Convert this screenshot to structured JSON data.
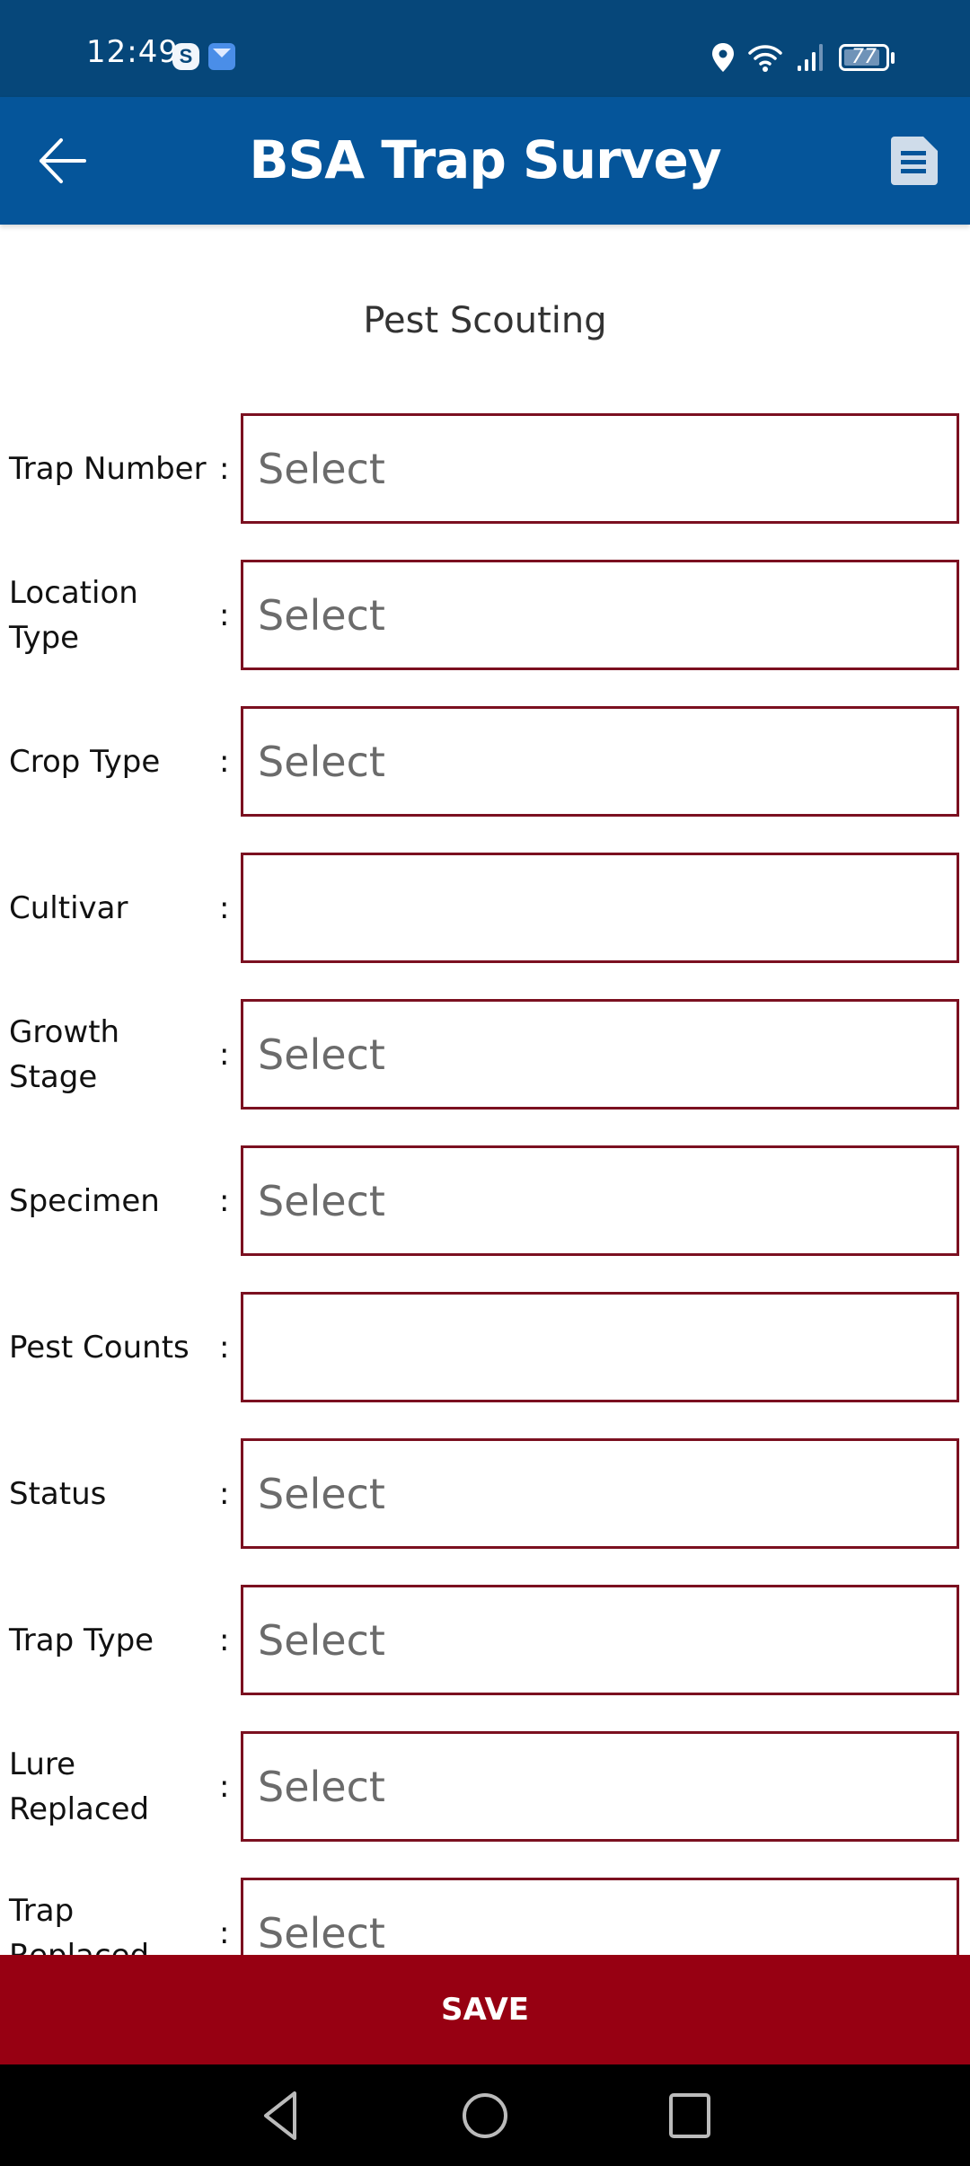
{
  "status_bar": {
    "time": "12:49",
    "notification_icons": [
      "skype-icon",
      "mail-icon"
    ],
    "system_icons": [
      "location-icon",
      "wifi-icon",
      "signal-icon",
      "battery-icon"
    ],
    "battery_level": "77",
    "skype_glyph": "S"
  },
  "app_bar": {
    "title": "BSA Trap Survey",
    "back_icon": "arrow-left-icon",
    "action_icon": "document-icon"
  },
  "section_title": "Pest Scouting",
  "form": {
    "fields": [
      {
        "label": "Trap Number",
        "value": "Select",
        "type": "select"
      },
      {
        "label": "Location Type",
        "value": "Select",
        "type": "select"
      },
      {
        "label": "Crop Type",
        "value": "Select",
        "type": "select"
      },
      {
        "label": "Cultivar",
        "value": "",
        "type": "text"
      },
      {
        "label": "Growth Stage",
        "value": "Select",
        "type": "select"
      },
      {
        "label": "Specimen",
        "value": "Select",
        "type": "select"
      },
      {
        "label": "Pest Counts",
        "value": "",
        "type": "text"
      },
      {
        "label": "Status",
        "value": "Select",
        "type": "select"
      },
      {
        "label": "Trap Type",
        "value": "Select",
        "type": "select"
      },
      {
        "label": "Lure Replaced",
        "value": "Select",
        "type": "select"
      },
      {
        "label": "Trap Replaced",
        "value": "Select",
        "type": "select"
      }
    ],
    "separator": ":"
  },
  "save_button": {
    "label": "SAVE"
  },
  "nav_bar": {
    "buttons": [
      "back",
      "home",
      "recents"
    ]
  },
  "colors": {
    "status_bar": "#06477a",
    "app_bar": "#05559a",
    "field_border": "#7b1020",
    "save_bar": "#970012"
  }
}
